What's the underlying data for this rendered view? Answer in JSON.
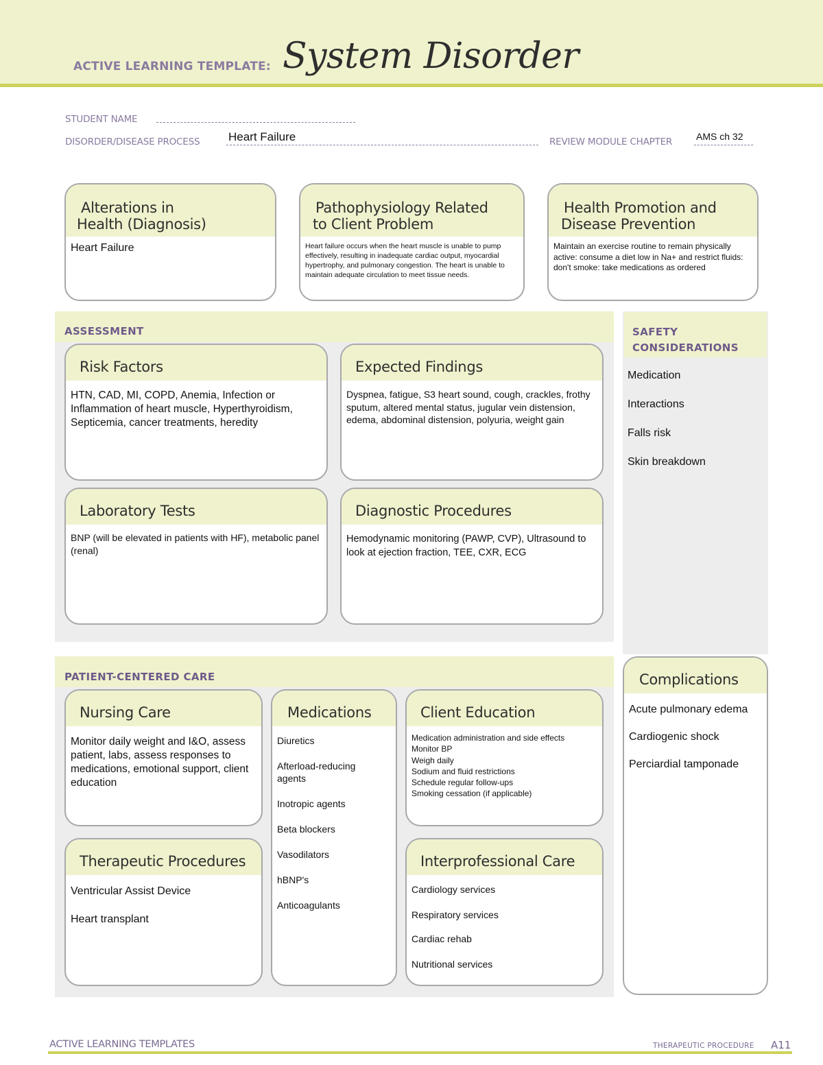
{
  "header": {
    "template_label": "ACTIVE LEARNING TEMPLATE:",
    "title": "System Disorder"
  },
  "fields": {
    "student_name_label": "STUDENT NAME",
    "student_name_value": "",
    "disorder_label": "DISORDER/DISEASE PROCESS",
    "disorder_value": "Heart Failure",
    "review_module_label": "REVIEW MODULE CHAPTER",
    "review_module_value": "AMS ch 32"
  },
  "top_cards": {
    "alterations": {
      "title_line1": "Alterations in",
      "title_line2": "Health (Diagnosis)",
      "body": "Heart Failure"
    },
    "pathophysiology": {
      "title_line1": "Pathophysiology Related",
      "title_line2": "to Client Problem",
      "body": "Heart failure occurs when the heart muscle is unable to pump effectively, resulting in inadequate cardiac output, myocardial hypertrophy, and pulmonary congestion. The heart is unable to maintain adequate circulation to meet tissue needs."
    },
    "health_promotion": {
      "title_line1": "Health Promotion and",
      "title_line2": "Disease Prevention",
      "body": "Maintain an exercise routine to remain physically active: consume a diet low in Na+ and restrict fluids: don't smoke: take medications as ordered"
    }
  },
  "assessment": {
    "section_title": "ASSESSMENT",
    "risk_factors": {
      "title": "Risk Factors",
      "body": "HTN, CAD, MI, COPD, Anemia, Infection or Inflammation of heart muscle, Hyperthyroidism, Septicemia, cancer treatments, heredity"
    },
    "expected_findings": {
      "title": "Expected Findings",
      "body": "Dyspnea, fatigue, S3 heart sound, cough, crackles, frothy sputum, altered mental status, jugular vein distension, edema, abdominal distension, polyuria, weight gain"
    },
    "laboratory_tests": {
      "title": "Laboratory Tests",
      "body": "BNP (will be elevated in patients with HF), metabolic panel (renal)"
    },
    "diagnostic_procedures": {
      "title": "Diagnostic Procedures",
      "body": "Hemodynamic monitoring (PAWP, CVP), Ultrasound to look at ejection fraction, TEE, CXR, ECG"
    }
  },
  "safety": {
    "section_title_line1": "SAFETY",
    "section_title_line2": "CONSIDERATIONS",
    "items": [
      "Medication",
      "Interactions",
      "Falls risk",
      "Skin breakdown"
    ]
  },
  "patient_centered_care": {
    "section_title": "PATIENT-CENTERED CARE",
    "nursing_care": {
      "title": "Nursing Care",
      "body": "Monitor daily weight and I&O, assess patient, labs, assess responses to medications, emotional support, client education"
    },
    "medications": {
      "title": "Medications",
      "items": [
        "Diuretics",
        "Afterload-reducing agents",
        "Inotropic agents",
        "Beta blockers",
        "Vasodilators",
        "hBNP's",
        "Anticoagulants"
      ]
    },
    "client_education": {
      "title": "Client Education",
      "items": [
        "Medication administration and side effects",
        "Monitor BP",
        "Weigh daily",
        "Sodium and fluid restrictions",
        "Schedule regular follow-ups",
        "Smoking cessation (if applicable)"
      ]
    },
    "therapeutic_procedures": {
      "title": "Therapeutic Procedures",
      "items": [
        "Ventricular Assist Device",
        "Heart transplant"
      ]
    },
    "interprofessional_care": {
      "title": "Interprofessional Care",
      "items": [
        "Cardiology services",
        "Respiratory services",
        "Cardiac rehab",
        "Nutritional services"
      ]
    }
  },
  "complications": {
    "title": "Complications",
    "items": [
      "Acute pulmonary edema",
      "Cardiogenic shock",
      "Perciardial tamponade"
    ]
  },
  "footer": {
    "left": "ACTIVE LEARNING TEMPLATES",
    "right": "THERAPEUTIC PROCEDURE",
    "page": "A11"
  },
  "colors": {
    "band": "#f0f2cd",
    "accent_rule": "#cdd35a",
    "label_purple": "#8a7aa0",
    "section_bg": "#ededed",
    "card_border": "#a8a8aa"
  }
}
